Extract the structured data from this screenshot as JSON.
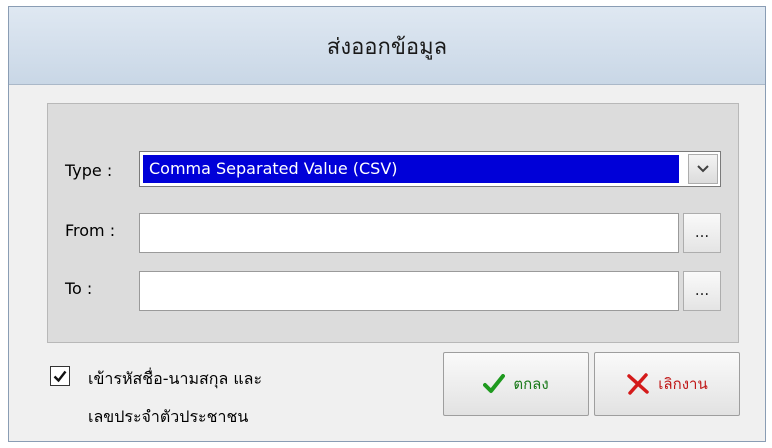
{
  "dialog": {
    "title": "ส่งออกข้อมูล"
  },
  "form": {
    "type_label": "Type :",
    "type_value": "Comma Separated Value (CSV)",
    "from_label": "From :",
    "from_value": "",
    "to_label": "To :",
    "to_value": "",
    "browse_label": "..."
  },
  "option": {
    "checked": true,
    "label_line1": "เข้ารหัสชื่อ-นามสกุล และ",
    "label_line2": "เลขประจำตัวประชาชน"
  },
  "buttons": {
    "ok_label": "ตกลง",
    "cancel_label": "เลิกงาน"
  },
  "colors": {
    "selection": "#0000d8",
    "ok_icon": "#1f9a1f",
    "cancel_icon": "#d41a1a"
  }
}
